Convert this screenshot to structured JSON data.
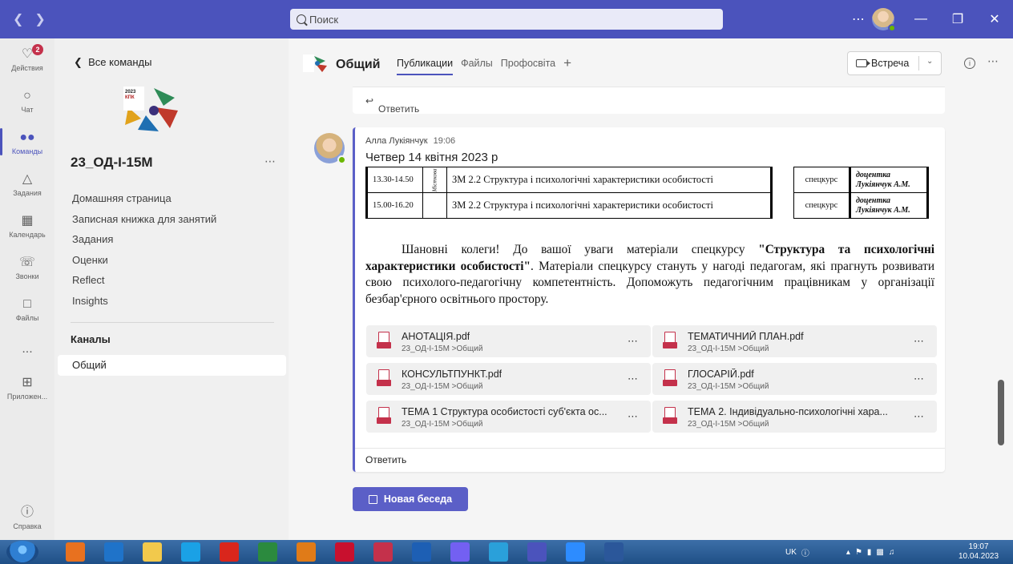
{
  "search": {
    "placeholder": "Поиск"
  },
  "rail": {
    "items": [
      {
        "label": "Действия",
        "badge": "2"
      },
      {
        "label": "Чат"
      },
      {
        "label": "Команды"
      },
      {
        "label": "Задания"
      },
      {
        "label": "Календарь"
      },
      {
        "label": "Звонки"
      },
      {
        "label": "Файлы"
      },
      {
        "label": "..."
      },
      {
        "label": "Приложен..."
      },
      {
        "label": "Справка"
      }
    ]
  },
  "teampanel": {
    "back": "Все команды",
    "team_name": "23_ОД-І-15М",
    "links": [
      "Домашняя страница",
      "Записная книжка для занятий",
      "Задания",
      "Оценки",
      "Reflect",
      "Insights"
    ],
    "channels_heading": "Каналы",
    "active_channel": "Общий"
  },
  "header": {
    "channel": "Общий",
    "tabs": [
      "Публикации",
      "Файлы",
      "Профосвіта"
    ],
    "meeting": "Встреча"
  },
  "post": {
    "prev_reply": "Ответить",
    "author": "Алла Лукіянчук",
    "time": "19:06",
    "subject": "Четвер 14 квітня 2023 р",
    "schedule": [
      {
        "time": "13.30-14.50",
        "venue": "Місткова",
        "subject": "ЗМ 2.2 Структура і психологічні характеристики особистості",
        "type": "спецкурс",
        "lecturer": "доцентка Лукіянчук А.М."
      },
      {
        "time": "15.00-16.20",
        "venue": "",
        "subject": "ЗМ 2.2 Структура і психологічні характеристики особистості",
        "type": "спецкурс",
        "lecturer": "доцентка Лукіянчук А.М."
      }
    ],
    "body_start": "Шановні колеги! До вашої уваги матеріали спецкурсу ",
    "body_bold": "\"Структура та психологічні характеристики особистості\"",
    "body_end": ". Матеріали спецкурсу стануть у нагоді педагогам, які прагнуть розвивати свою психолого-педагогічну компетентність. Допоможуть педагогічним працівникам у організації безбар'єрного освітнього простору.",
    "files": [
      {
        "name": "АНОТАЦІЯ.pdf",
        "path": "23_ОД-І-15М >Общий"
      },
      {
        "name": "ТЕМАТИЧНИЙ ПЛАН.pdf",
        "path": "23_ОД-І-15М >Общий"
      },
      {
        "name": "КОНСУЛЬТПУНКТ.pdf",
        "path": "23_ОД-І-15М >Общий"
      },
      {
        "name": "ГЛОСАРІЙ.pdf",
        "path": "23_ОД-І-15М >Общий"
      },
      {
        "name": "ТЕМА 1 Структура особистості суб'єкта ос...",
        "path": "23_ОД-І-15М >Общий"
      },
      {
        "name": "ТЕМА 2. Індивідуально-психологічні хара...",
        "path": "23_ОД-І-15М >Общий"
      }
    ],
    "reply": "Ответить"
  },
  "new_conversation": "Новая беседа",
  "taskbar": {
    "lang": "UK",
    "time": "19:07",
    "date": "10.04.2023",
    "app_colors": [
      "#e8711f",
      "#1f73c9",
      "#f2c94c",
      "#1aa1e6",
      "#d9261c",
      "#2b8a3e",
      "#e07b18",
      "#c8102e",
      "#c4314b",
      "#1d5fb4",
      "#7360f2",
      "#2aa0da",
      "#4b53bc",
      "#2d8cff",
      "#2b579a"
    ]
  }
}
